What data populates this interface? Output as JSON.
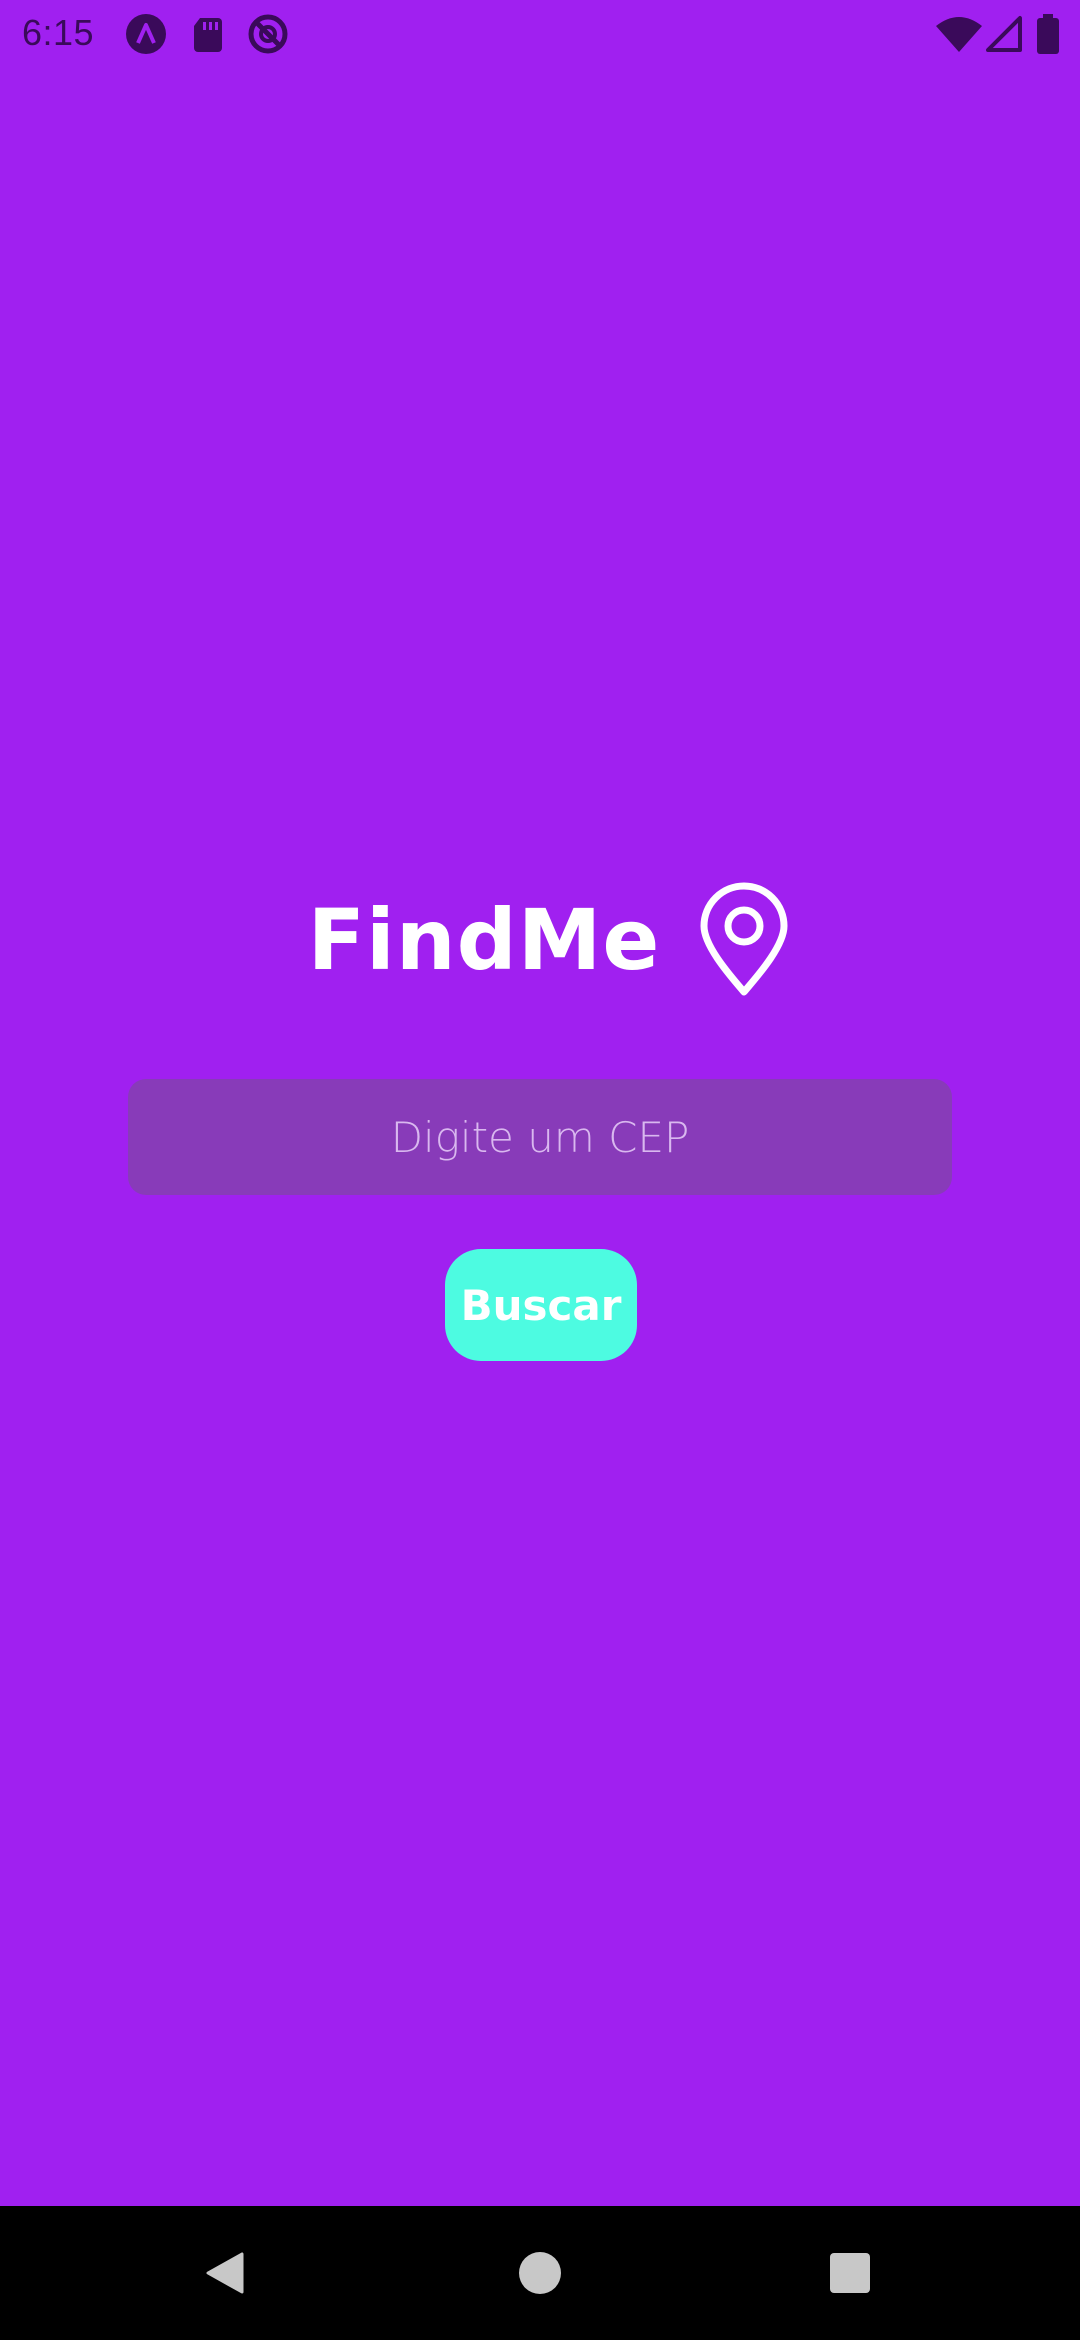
{
  "status_bar": {
    "time": "6:15",
    "left_icons": [
      "app-a-icon",
      "sd-card-icon",
      "do-not-disturb-icon"
    ],
    "right_icons": [
      "wifi-icon",
      "cellular-signal-icon",
      "battery-icon"
    ],
    "icon_color": "#3a0a5a"
  },
  "main": {
    "title": "FindMe",
    "title_icon": "map-pin-icon",
    "cep_input": {
      "value": "",
      "placeholder": "Digite um CEP"
    },
    "search_button": {
      "label": "Buscar"
    }
  },
  "nav_bar": {
    "buttons": [
      "back-icon",
      "home-icon",
      "recents-icon"
    ]
  },
  "colors": {
    "background": "#a020f0",
    "input_background": "#883bb9",
    "button_background": "#4dfbe1",
    "text": "#ffffff",
    "nav_background": "#000000",
    "nav_icons": "#c8c8c8"
  }
}
